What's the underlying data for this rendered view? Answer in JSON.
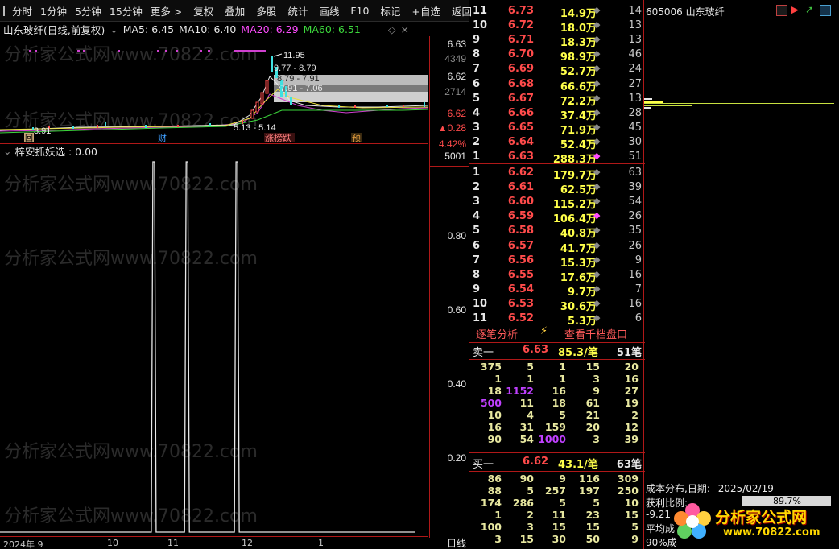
{
  "toolbar": {
    "tabs": [
      "分时",
      "1分钟",
      "5分钟",
      "15分钟",
      "更多 >"
    ],
    "tools": [
      "复权",
      "叠加",
      "多股",
      "统计",
      "画线",
      "F10",
      "标记",
      "+自选",
      "返回"
    ]
  },
  "chart": {
    "title": "山东玻纤(日线,前复权)",
    "ma": [
      {
        "label": "MA5: 6.45",
        "color": "#e8e8e8"
      },
      {
        "label": "MA10: 6.40",
        "color": "#e8e8e8"
      },
      {
        "label": "MA20: 6.29",
        "color": "#ff4cff"
      },
      {
        "label": "MA60: 6.51",
        "color": "#3cd73c"
      }
    ],
    "annotations": {
      "high": "11.95",
      "a1": "9.77 - 8.79",
      "a2": "8.79 - 7.91",
      "a3": "7.91 - 7.06",
      "low_left": "3.91",
      "low_mid": "5.13 - 5.14"
    },
    "markers": {
      "hui": "回",
      "cai": "财",
      "zhangtie": "涨榜跌",
      "yu": "预"
    },
    "y_top": {
      "p1": "6.63",
      "v1": "4349",
      "p2": "6.62",
      "v2": "2714",
      "p3": "6.62",
      "chg": "▲0.28",
      "pct": "4.42%",
      "vol": "5001"
    },
    "indicator_title": "梓安抓妖选 : 0.00",
    "indicator_y": [
      "0.80",
      "0.60",
      "0.40",
      "0.20"
    ],
    "x_labels": [
      "2024年 9",
      "10",
      "11",
      "12",
      "1",
      "日线"
    ],
    "watermark": "分析家公式网www.70822.com"
  },
  "chart_data": {
    "type": "line",
    "title": "梓安抓妖选",
    "ylim": [
      0,
      1
    ],
    "spikes_at_fraction": [
      0.37,
      0.45,
      0.57
    ],
    "spike_value": 1.0
  },
  "asks": [
    {
      "lvl": "11",
      "px": "6.73",
      "vol": "14.9万",
      "cnt": "14"
    },
    {
      "lvl": "10",
      "px": "6.72",
      "vol": "18.0万",
      "cnt": "13"
    },
    {
      "lvl": "9",
      "px": "6.71",
      "vol": "18.3万",
      "cnt": "13"
    },
    {
      "lvl": "8",
      "px": "6.70",
      "vol": "98.9万",
      "cnt": "46"
    },
    {
      "lvl": "7",
      "px": "6.69",
      "vol": "52.7万",
      "cnt": "24"
    },
    {
      "lvl": "6",
      "px": "6.68",
      "vol": "66.6万",
      "cnt": "27"
    },
    {
      "lvl": "5",
      "px": "6.67",
      "vol": "72.2万",
      "cnt": "13"
    },
    {
      "lvl": "4",
      "px": "6.66",
      "vol": "37.4万",
      "cnt": "28"
    },
    {
      "lvl": "3",
      "px": "6.65",
      "vol": "71.9万",
      "cnt": "45"
    },
    {
      "lvl": "2",
      "px": "6.64",
      "vol": "52.4万",
      "cnt": "30"
    },
    {
      "lvl": "1",
      "px": "6.63",
      "vol": "288.3万",
      "cnt": "51"
    }
  ],
  "bids": [
    {
      "lvl": "1",
      "px": "6.62",
      "vol": "179.7万",
      "cnt": "63"
    },
    {
      "lvl": "2",
      "px": "6.61",
      "vol": "62.5万",
      "cnt": "39"
    },
    {
      "lvl": "3",
      "px": "6.60",
      "vol": "115.2万",
      "cnt": "54"
    },
    {
      "lvl": "4",
      "px": "6.59",
      "vol": "106.4万",
      "cnt": "26"
    },
    {
      "lvl": "5",
      "px": "6.58",
      "vol": "40.8万",
      "cnt": "35"
    },
    {
      "lvl": "6",
      "px": "6.57",
      "vol": "41.7万",
      "cnt": "26"
    },
    {
      "lvl": "7",
      "px": "6.56",
      "vol": "15.3万",
      "cnt": "9"
    },
    {
      "lvl": "8",
      "px": "6.55",
      "vol": "17.6万",
      "cnt": "16"
    },
    {
      "lvl": "9",
      "px": "6.54",
      "vol": "9.7万",
      "cnt": "7"
    },
    {
      "lvl": "10",
      "px": "6.53",
      "vol": "30.6万",
      "cnt": "16"
    },
    {
      "lvl": "11",
      "px": "6.52",
      "vol": "5.3万",
      "cnt": "6"
    }
  ],
  "links": {
    "detail": "逐笔分析",
    "kilo": "查看千档盘口"
  },
  "sell1": {
    "label": "卖一",
    "px": "6.63",
    "vol": "85.3/笔",
    "cnt": "51笔",
    "rows": [
      [
        "375",
        "5",
        "1",
        "15",
        "20"
      ],
      [
        "1",
        "1",
        "1",
        "3",
        "16"
      ],
      [
        "18",
        "1152",
        "16",
        "9",
        "27"
      ],
      [
        "500",
        "11",
        "18",
        "61",
        "19"
      ],
      [
        "10",
        "4",
        "5",
        "21",
        "2"
      ],
      [
        "16",
        "31",
        "159",
        "20",
        "12"
      ],
      [
        "90",
        "54",
        "1000",
        "3",
        "39"
      ]
    ]
  },
  "buy1": {
    "label": "买一",
    "px": "6.62",
    "vol": "43.1/笔",
    "cnt": "63笔",
    "rows": [
      [
        "86",
        "90",
        "9",
        "116",
        "309"
      ],
      [
        "88",
        "5",
        "257",
        "197",
        "250"
      ],
      [
        "174",
        "286",
        "5",
        "5",
        "10"
      ],
      [
        "1",
        "2",
        "11",
        "23",
        "15"
      ],
      [
        "100",
        "3",
        "15",
        "15",
        "5"
      ],
      [
        "3",
        "15",
        "30",
        "50",
        "9"
      ]
    ]
  },
  "rpanel": {
    "code": "605006 山东玻纤",
    "cost_title": "成本分布,日期:",
    "cost_date": "2025/02/19",
    "profit_label": "获利比例:",
    "profit_value": "89.7%",
    "neg_value": "-9.21",
    "avg_label": "平均成",
    "pct90": "90%成",
    "logo_text": "分析家公式网",
    "logo_url": "www.70822.com"
  }
}
